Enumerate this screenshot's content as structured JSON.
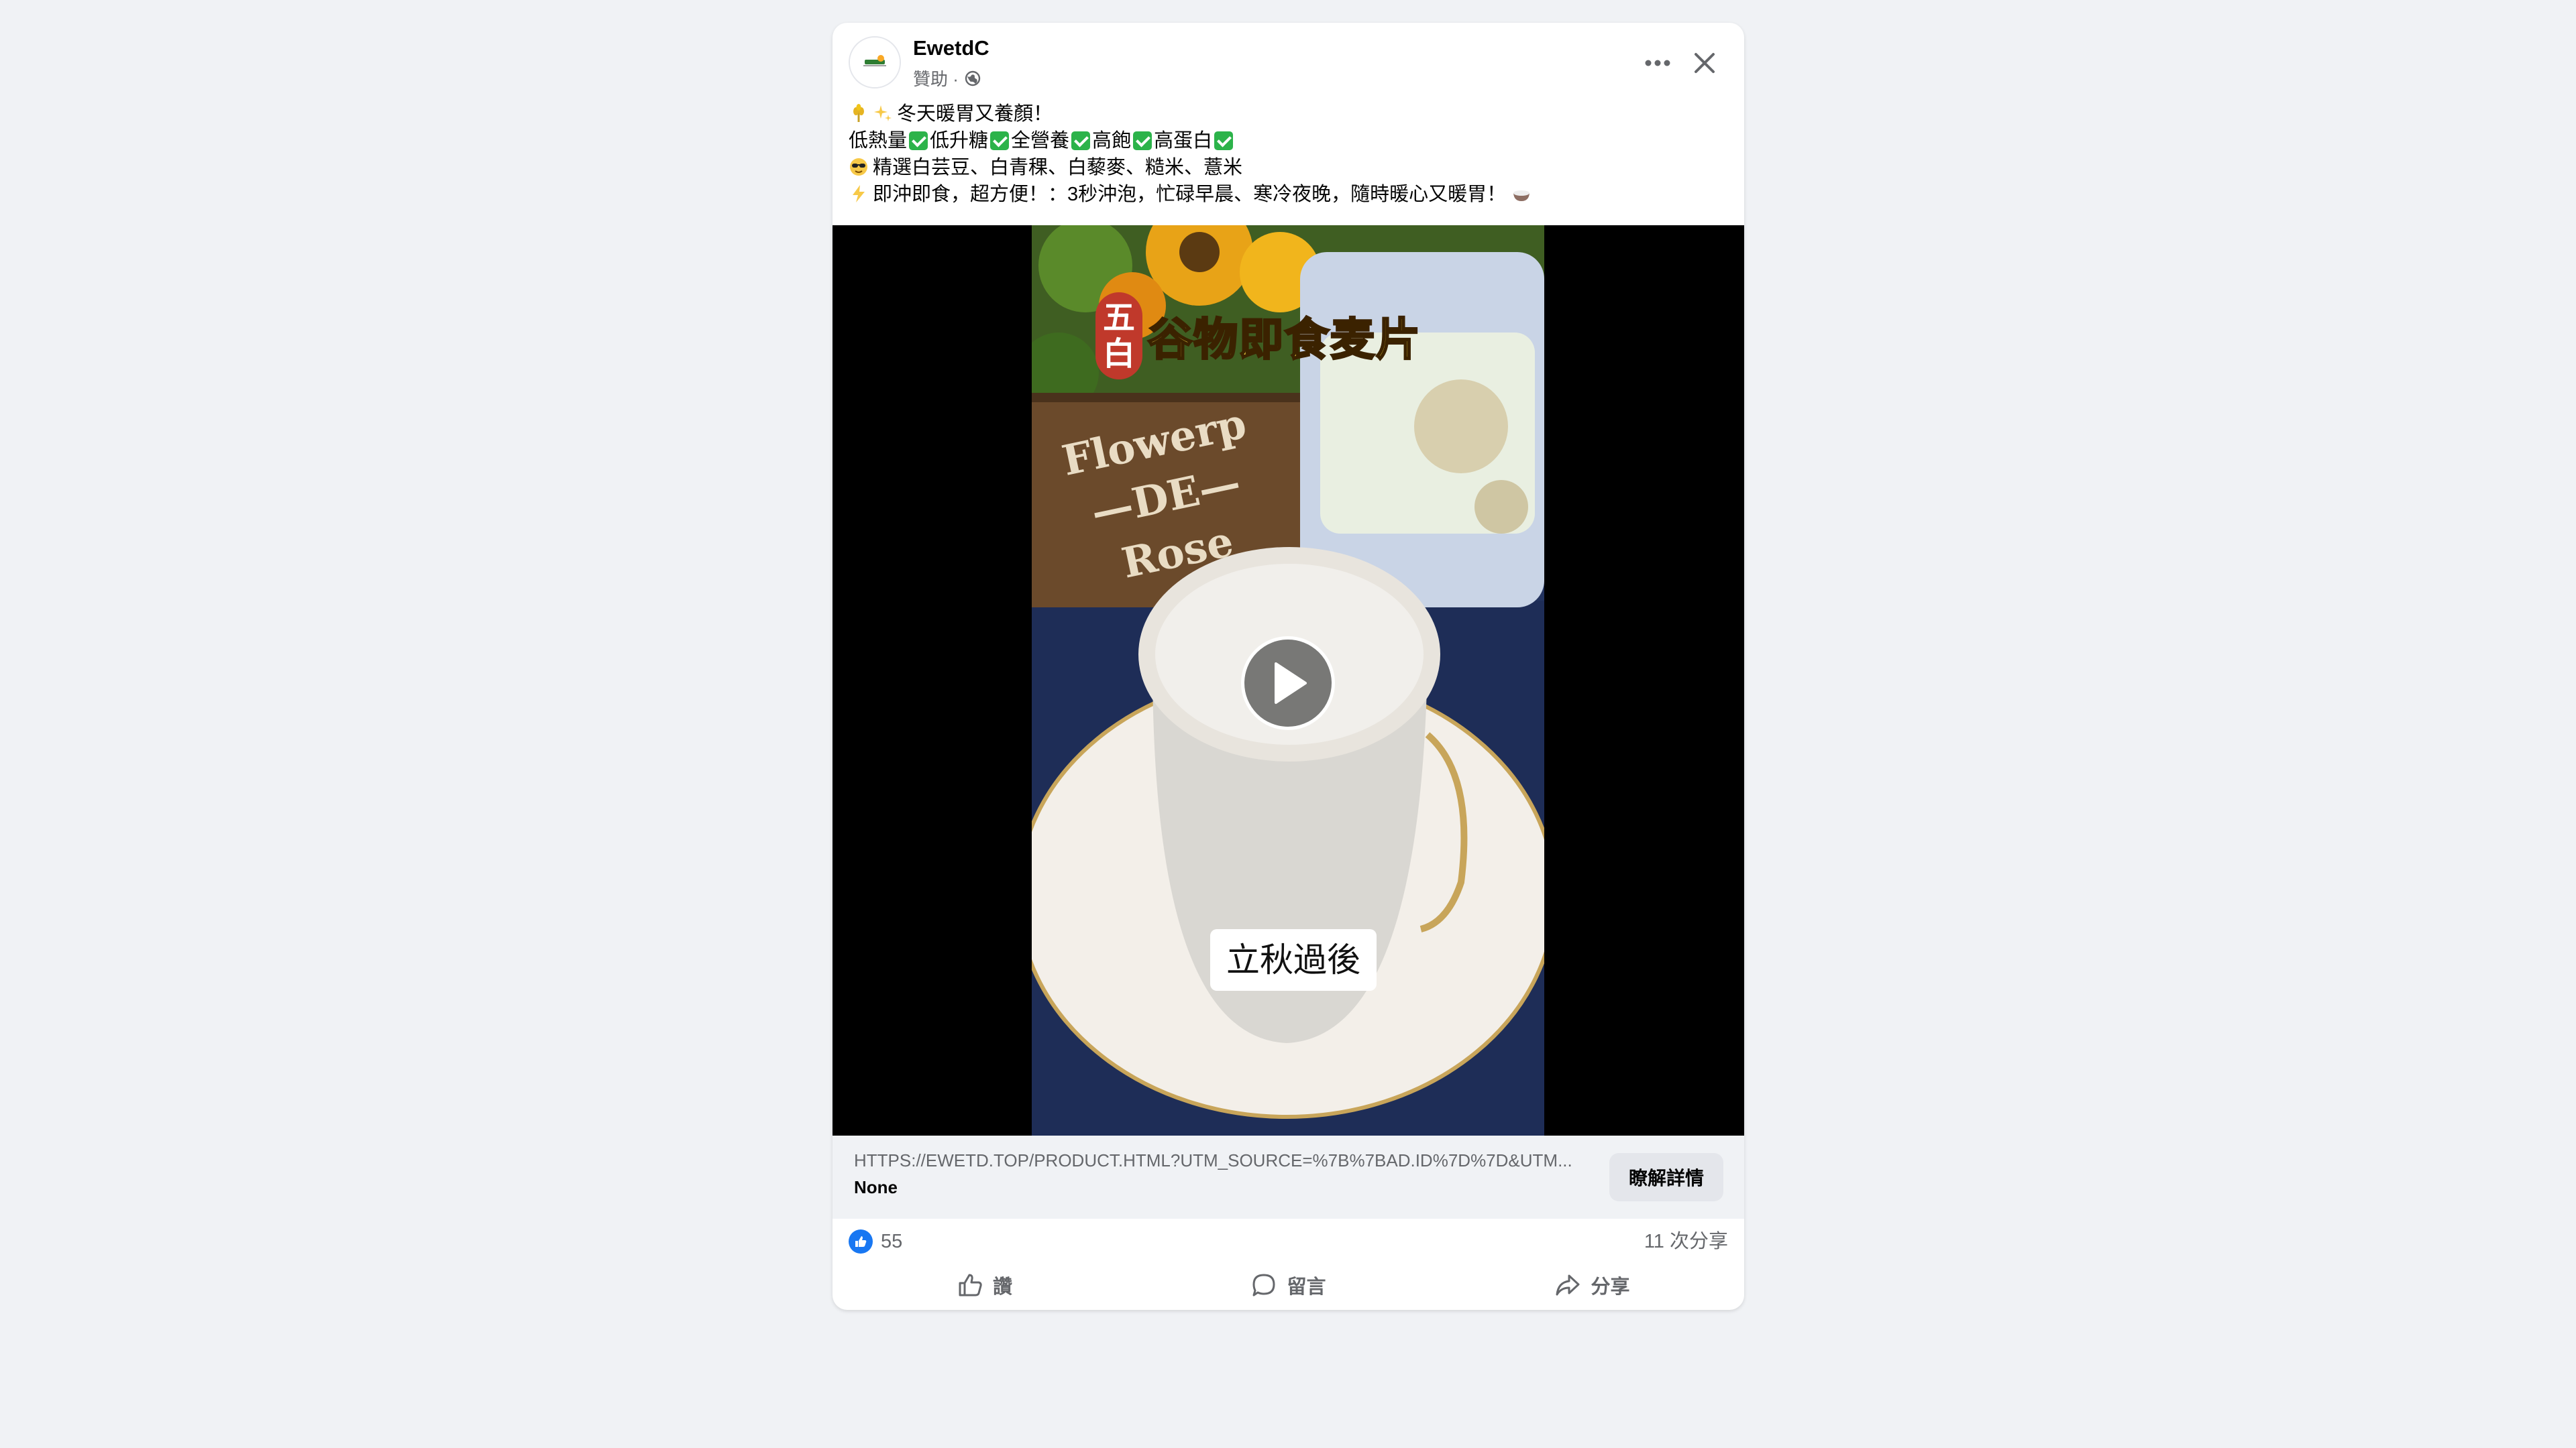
{
  "post": {
    "page_name": "EwetdC",
    "sponsored_label": "贊助 ·",
    "text_lines": [
      "冬天暖胃又養顏！",
      "低熱量",
      "低升糖",
      "全營養",
      "高飽",
      "高蛋白",
      "精選白芸豆、白青稞、白藜麥、糙米、薏米",
      "即沖即食，超方便！：3秒沖泡，忙碌早晨、寒冷夜晚，隨時暖心又暖胃！"
    ]
  },
  "video": {
    "badge_top": "五",
    "badge_bottom": "白",
    "title": "谷物即食麦片",
    "box_text_1": "Flowerp",
    "box_text_2": "—DE—",
    "box_text_3": "Rose",
    "caption": "立秋過後"
  },
  "link": {
    "url": "HTTPS://EWETD.TOP/PRODUCT.HTML?UTM_SOURCE=%7B%7BAD.ID%7D%7D&UTM...",
    "title": "None",
    "cta_label": "瞭解詳情"
  },
  "stats": {
    "reactions": "55",
    "shares": "11 次分享"
  },
  "actions": {
    "like": "讚",
    "comment": "留言",
    "share": "分享"
  },
  "colors": {
    "accent": "#1877f2",
    "check": "#2cb34a",
    "title_yellow": "#ffe347",
    "badge_red": "#c0392b"
  }
}
